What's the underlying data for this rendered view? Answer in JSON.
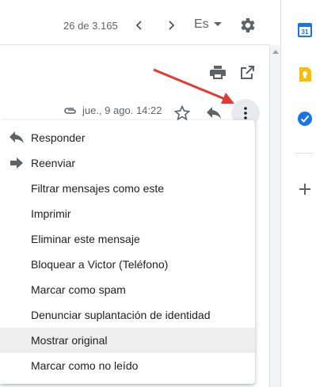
{
  "toolbar": {
    "counter": "26 de 3.165",
    "language": "Es"
  },
  "email": {
    "date": "jue., 9 ago. 14:22"
  },
  "menu": {
    "items": [
      {
        "label": "Responder",
        "icon": "reply-icon"
      },
      {
        "label": "Reenviar",
        "icon": "forward-icon"
      },
      {
        "label": "Filtrar mensajes como este"
      },
      {
        "label": "Imprimir"
      },
      {
        "label": "Eliminar este mensaje"
      },
      {
        "label": "Bloquear a Victor (Teléfono)"
      },
      {
        "label": "Marcar como spam"
      },
      {
        "label": "Denunciar suplantación de identidad"
      },
      {
        "label": "Mostrar original",
        "highlighted": true
      },
      {
        "label": "Marcar como no leído"
      }
    ]
  },
  "side_panel": {
    "calendar_day": "31",
    "icons": [
      "calendar-icon",
      "keep-icon",
      "tasks-icon",
      "add-icon"
    ]
  },
  "colors": {
    "annotation_arrow": "#e53935",
    "menu_highlight": "#eeeeee",
    "icon_gray": "#5f6368"
  }
}
